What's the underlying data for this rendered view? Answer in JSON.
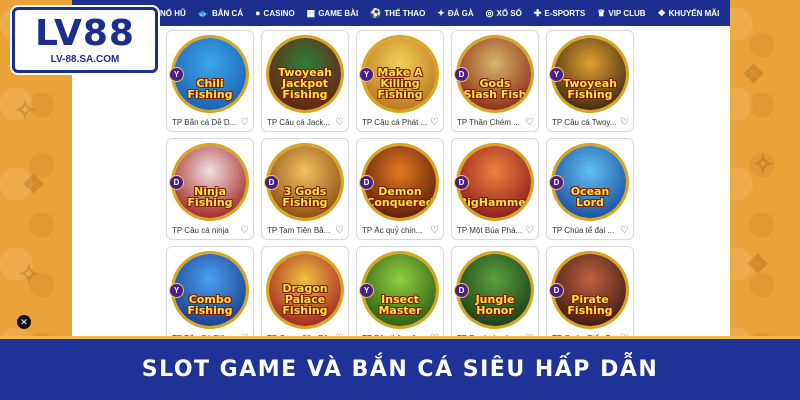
{
  "logo": {
    "text": "LV88",
    "domain": "LV-88.SA.COM"
  },
  "nav": [
    {
      "label": "NỔ HŨ",
      "icon": "slot-icon"
    },
    {
      "label": "BẮN CÁ",
      "icon": "fish-icon"
    },
    {
      "label": "CASINO",
      "icon": "casino-chip-icon"
    },
    {
      "label": "GAME BÀI",
      "icon": "cards-icon"
    },
    {
      "label": "THỂ THAO",
      "icon": "soccer-ball-icon"
    },
    {
      "label": "ĐÁ GÀ",
      "icon": "rooster-icon"
    },
    {
      "label": "XỔ SỐ",
      "icon": "lottery-icon"
    },
    {
      "label": "E-SPORTS",
      "icon": "gamepad-icon"
    },
    {
      "label": "VIP CLUB",
      "icon": "crown-icon"
    },
    {
      "label": "KHUYẾN MÃI",
      "icon": "gift-icon"
    }
  ],
  "games": [
    {
      "title": "Chili Fishing",
      "caption": "TP Bắn cá Dễ D...",
      "provider": "Y",
      "colors": [
        "#3aa7e8",
        "#1b5fb0"
      ]
    },
    {
      "title": "Twoyeah Jackpot Fishing",
      "caption": "TP Câu cá Jack...",
      "provider": "",
      "colors": [
        "#2f7d3a",
        "#6b1f0e"
      ]
    },
    {
      "title": "Make A Killing Fishing",
      "caption": "TP Câu cá Phát ...",
      "provider": "Y",
      "colors": [
        "#f2d15a",
        "#b8741a"
      ]
    },
    {
      "title": "Gods Slash Fish",
      "caption": "TP Thần Chém ...",
      "provider": "D",
      "colors": [
        "#d8b46a",
        "#8a2a14"
      ]
    },
    {
      "title": "Twoyeah Fishing",
      "caption": "TP Câu cá Twoy...",
      "provider": "Y",
      "colors": [
        "#e0a030",
        "#3a2410"
      ]
    },
    {
      "title": "Ninja Fishing",
      "caption": "TP Câu cá ninja",
      "provider": "D",
      "colors": [
        "#f0e0e0",
        "#a02020"
      ]
    },
    {
      "title": "3 Gods Fishing",
      "caption": "TP Tam Tiên Bắ...",
      "provider": "D",
      "colors": [
        "#f0c060",
        "#8a4a10"
      ]
    },
    {
      "title": "Demon Conquered",
      "caption": "TP Ác quỷ chin...",
      "provider": "D",
      "colors": [
        "#e07a20",
        "#5a1a08"
      ]
    },
    {
      "title": "BigHammer",
      "caption": "TP Một Búa Phá...",
      "provider": "D",
      "colors": [
        "#f08040",
        "#8a1a1a"
      ]
    },
    {
      "title": "Ocean Lord",
      "caption": "TP Chúa tể đại ...",
      "provider": "D",
      "colors": [
        "#60c0f0",
        "#1a4a9a"
      ]
    },
    {
      "title": "Combo Fishing",
      "caption": "TP Bắn Cá Siê...",
      "provider": "Y",
      "colors": [
        "#4aa0f0",
        "#1a3a8a"
      ]
    },
    {
      "title": "Dragon Palace Fishing",
      "caption": "TP Cung điện Rồ...",
      "provider": "",
      "colors": [
        "#f0c040",
        "#a02020"
      ]
    },
    {
      "title": "Insect Master",
      "caption": "TP Bậc thầy côn...",
      "provider": "Y",
      "colors": [
        "#90d040",
        "#2a5a10"
      ]
    },
    {
      "title": "Jungle Honor",
      "caption": "TP Danh dự rừ...",
      "provider": "D",
      "colors": [
        "#5aa040",
        "#1a3a14"
      ]
    },
    {
      "title": "Pirate Fishing",
      "caption": "TP Cướp Biển Bắ...",
      "provider": "D",
      "colors": [
        "#c06040",
        "#3a1a10"
      ]
    }
  ],
  "banner": {
    "text": "SLOT GAME VÀ BẮN CÁ SIÊU HẤP DẪN"
  },
  "close_label": "✕",
  "colors": {
    "brand_blue": "#1c2f8f",
    "accent_orange": "#eba238",
    "gold": "#d9a520"
  }
}
